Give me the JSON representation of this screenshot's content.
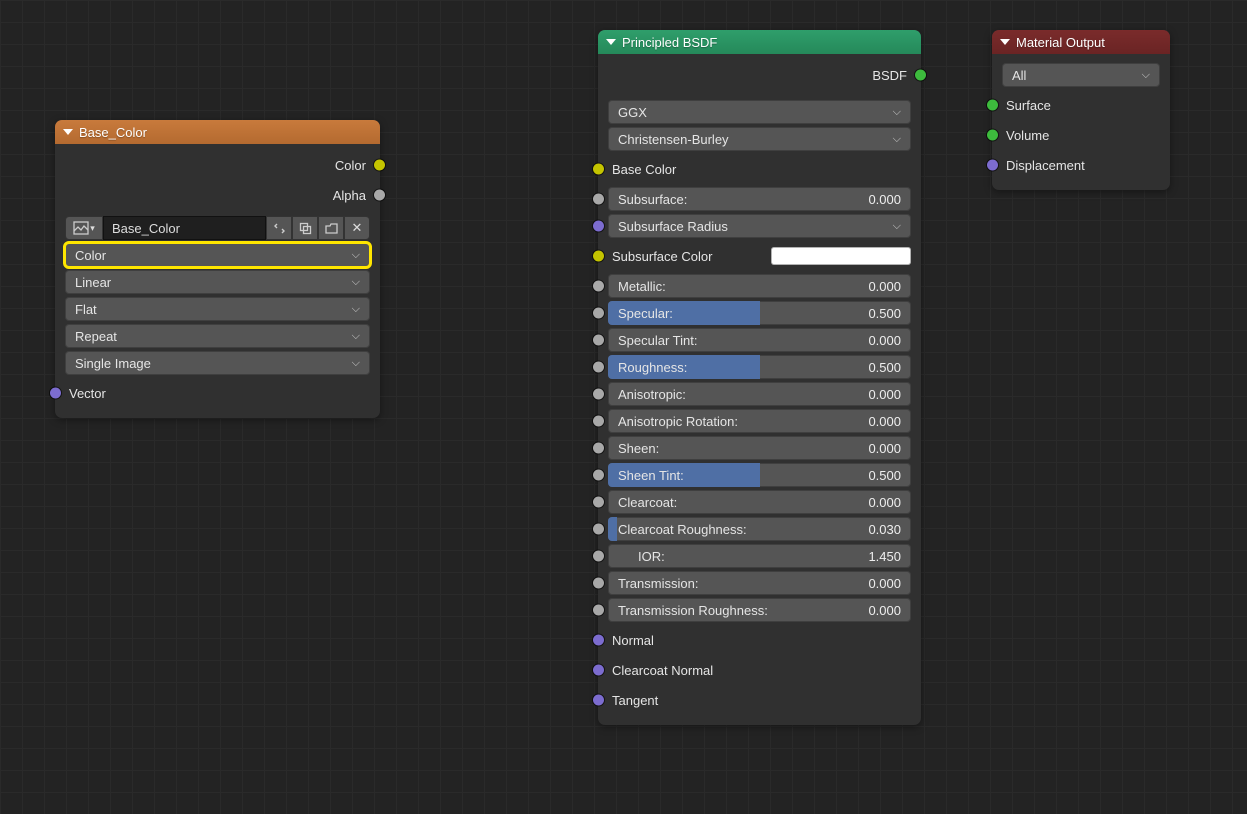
{
  "baseColorNode": {
    "title": "Base_Color",
    "outputs": {
      "color": "Color",
      "alpha": "Alpha"
    },
    "imageName": "Base_Color",
    "colorspace": "Color",
    "interpolation": "Linear",
    "projection": "Flat",
    "extension": "Repeat",
    "imageMode": "Single Image",
    "vectorInput": "Vector"
  },
  "bsdfNode": {
    "title": "Principled BSDF",
    "outputLabel": "BSDF",
    "distribution": "GGX",
    "subsurfMethod": "Christensen-Burley",
    "inputs": [
      {
        "name": "Base Color",
        "type": "label",
        "sock": "yellow"
      },
      {
        "name": "Subsurface:",
        "type": "slider",
        "value": "0.000",
        "fill": 0,
        "sock": "gray"
      },
      {
        "name": "Subsurface Radius",
        "type": "drop",
        "sock": "purple"
      },
      {
        "name": "Subsurface Color",
        "type": "swatch",
        "sock": "yellow"
      },
      {
        "name": "Metallic:",
        "type": "slider",
        "value": "0.000",
        "fill": 0,
        "sock": "gray"
      },
      {
        "name": "Specular:",
        "type": "slider",
        "value": "0.500",
        "fill": 50,
        "sock": "gray"
      },
      {
        "name": "Specular Tint:",
        "type": "slider",
        "value": "0.000",
        "fill": 0,
        "sock": "gray"
      },
      {
        "name": "Roughness:",
        "type": "slider",
        "value": "0.500",
        "fill": 50,
        "sock": "gray"
      },
      {
        "name": "Anisotropic:",
        "type": "slider",
        "value": "0.000",
        "fill": 0,
        "sock": "gray"
      },
      {
        "name": "Anisotropic Rotation:",
        "type": "slider",
        "value": "0.000",
        "fill": 0,
        "sock": "gray"
      },
      {
        "name": "Sheen:",
        "type": "slider",
        "value": "0.000",
        "fill": 0,
        "sock": "gray"
      },
      {
        "name": "Sheen Tint:",
        "type": "slider",
        "value": "0.500",
        "fill": 50,
        "sock": "gray"
      },
      {
        "name": "Clearcoat:",
        "type": "slider",
        "value": "0.000",
        "fill": 0,
        "sock": "gray"
      },
      {
        "name": "Clearcoat Roughness:",
        "type": "slider",
        "value": "0.030",
        "fill": 3,
        "sock": "gray"
      },
      {
        "name": "IOR:",
        "type": "slider",
        "value": "1.450",
        "fill": 0,
        "sock": "gray",
        "center": true
      },
      {
        "name": "Transmission:",
        "type": "slider",
        "value": "0.000",
        "fill": 0,
        "sock": "gray"
      },
      {
        "name": "Transmission Roughness:",
        "type": "slider",
        "value": "0.000",
        "fill": 0,
        "sock": "gray"
      },
      {
        "name": "Normal",
        "type": "label",
        "sock": "purple"
      },
      {
        "name": "Clearcoat Normal",
        "type": "label",
        "sock": "purple"
      },
      {
        "name": "Tangent",
        "type": "label",
        "sock": "purple"
      }
    ]
  },
  "outputNode": {
    "title": "Material Output",
    "target": "All",
    "inputs": [
      {
        "name": "Surface",
        "sock": "green"
      },
      {
        "name": "Volume",
        "sock": "green"
      },
      {
        "name": "Displacement",
        "sock": "purple"
      }
    ]
  }
}
